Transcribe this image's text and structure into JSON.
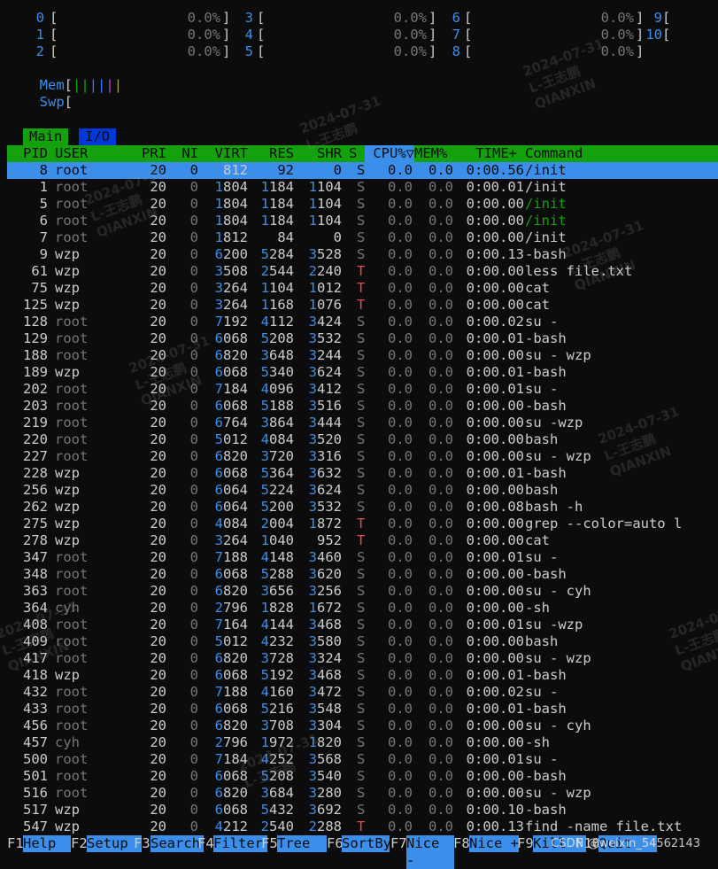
{
  "cpu_meters": [
    {
      "id": "0",
      "pct": "0.0%"
    },
    {
      "id": "1",
      "pct": "0.0%"
    },
    {
      "id": "2",
      "pct": "0.0%"
    },
    {
      "id": "3",
      "pct": "0.0%"
    },
    {
      "id": "4",
      "pct": "0.0%"
    },
    {
      "id": "5",
      "pct": "0.0%"
    },
    {
      "id": "6",
      "pct": "0.0%"
    },
    {
      "id": "7",
      "pct": "0.0%"
    },
    {
      "id": "8",
      "pct": "0.0%"
    },
    {
      "id": "9",
      "pct": ""
    },
    {
      "id": "10",
      "pct": ""
    }
  ],
  "mem": {
    "label": "Mem",
    "bars": "||||||"
  },
  "swp": {
    "label": "Swp"
  },
  "tabs": {
    "main": "Main",
    "io": "I/O"
  },
  "columns": {
    "pid": "PID",
    "user": "USER",
    "pri": "PRI",
    "ni": "NI",
    "virt": "VIRT",
    "res": "RES",
    "shr": "SHR",
    "s": "S",
    "cpu": "CPU%▽",
    "mem": "MEM%",
    "time": "TIME+",
    "command": "Command"
  },
  "processes": [
    {
      "pid": "8",
      "user": "root",
      "pri": "20",
      "ni": "0",
      "virt": "1812",
      "res": "92",
      "shr": "0",
      "s": "S",
      "cpu": "0.0",
      "mem": "0.0",
      "time": "0:00.56",
      "command": "/init",
      "selected": true
    },
    {
      "pid": "1",
      "user": "root",
      "pri": "20",
      "ni": "0",
      "virt": "1804",
      "res": "1184",
      "shr": "1104",
      "s": "S",
      "cpu": "0.0",
      "mem": "0.0",
      "time": "0:00.01",
      "command": "/init"
    },
    {
      "pid": "5",
      "user": "root",
      "pri": "20",
      "ni": "0",
      "virt": "1804",
      "res": "1184",
      "shr": "1104",
      "s": "S",
      "cpu": "0.0",
      "mem": "0.0",
      "time": "0:00.00",
      "command": "/init",
      "thread": true
    },
    {
      "pid": "6",
      "user": "root",
      "pri": "20",
      "ni": "0",
      "virt": "1804",
      "res": "1184",
      "shr": "1104",
      "s": "S",
      "cpu": "0.0",
      "mem": "0.0",
      "time": "0:00.00",
      "command": "/init",
      "thread": true
    },
    {
      "pid": "7",
      "user": "root",
      "pri": "20",
      "ni": "0",
      "virt": "1812",
      "res": "84",
      "shr": "0",
      "s": "S",
      "cpu": "0.0",
      "mem": "0.0",
      "time": "0:00.00",
      "command": "/init"
    },
    {
      "pid": "9",
      "user": "wzp",
      "pri": "20",
      "ni": "0",
      "virt": "6200",
      "res": "5284",
      "shr": "3528",
      "s": "S",
      "cpu": "0.0",
      "mem": "0.0",
      "time": "0:00.13",
      "command": "-bash"
    },
    {
      "pid": "61",
      "user": "wzp",
      "pri": "20",
      "ni": "0",
      "virt": "3508",
      "res": "2544",
      "shr": "2240",
      "s": "T",
      "cpu": "0.0",
      "mem": "0.0",
      "time": "0:00.00",
      "command": "less file.txt"
    },
    {
      "pid": "75",
      "user": "wzp",
      "pri": "20",
      "ni": "0",
      "virt": "3264",
      "res": "1104",
      "shr": "1012",
      "s": "T",
      "cpu": "0.0",
      "mem": "0.0",
      "time": "0:00.00",
      "command": "cat"
    },
    {
      "pid": "125",
      "user": "wzp",
      "pri": "20",
      "ni": "0",
      "virt": "3264",
      "res": "1168",
      "shr": "1076",
      "s": "T",
      "cpu": "0.0",
      "mem": "0.0",
      "time": "0:00.00",
      "command": "cat"
    },
    {
      "pid": "128",
      "user": "root",
      "pri": "20",
      "ni": "0",
      "virt": "7192",
      "res": "4112",
      "shr": "3424",
      "s": "S",
      "cpu": "0.0",
      "mem": "0.0",
      "time": "0:00.02",
      "command": "su -"
    },
    {
      "pid": "129",
      "user": "root",
      "pri": "20",
      "ni": "0",
      "virt": "6068",
      "res": "5208",
      "shr": "3532",
      "s": "S",
      "cpu": "0.0",
      "mem": "0.0",
      "time": "0:00.01",
      "command": "-bash"
    },
    {
      "pid": "188",
      "user": "root",
      "pri": "20",
      "ni": "0",
      "virt": "6820",
      "res": "3648",
      "shr": "3244",
      "s": "S",
      "cpu": "0.0",
      "mem": "0.0",
      "time": "0:00.00",
      "command": "su - wzp"
    },
    {
      "pid": "189",
      "user": "wzp",
      "pri": "20",
      "ni": "0",
      "virt": "6068",
      "res": "5340",
      "shr": "3624",
      "s": "S",
      "cpu": "0.0",
      "mem": "0.0",
      "time": "0:00.01",
      "command": "-bash"
    },
    {
      "pid": "202",
      "user": "root",
      "pri": "20",
      "ni": "0",
      "virt": "7184",
      "res": "4096",
      "shr": "3412",
      "s": "S",
      "cpu": "0.0",
      "mem": "0.0",
      "time": "0:00.01",
      "command": "su -"
    },
    {
      "pid": "203",
      "user": "root",
      "pri": "20",
      "ni": "0",
      "virt": "6068",
      "res": "5188",
      "shr": "3516",
      "s": "S",
      "cpu": "0.0",
      "mem": "0.0",
      "time": "0:00.00",
      "command": "-bash"
    },
    {
      "pid": "219",
      "user": "root",
      "pri": "20",
      "ni": "0",
      "virt": "6764",
      "res": "3864",
      "shr": "3444",
      "s": "S",
      "cpu": "0.0",
      "mem": "0.0",
      "time": "0:00.00",
      "command": "su -wzp"
    },
    {
      "pid": "220",
      "user": "root",
      "pri": "20",
      "ni": "0",
      "virt": "5012",
      "res": "4084",
      "shr": "3520",
      "s": "S",
      "cpu": "0.0",
      "mem": "0.0",
      "time": "0:00.00",
      "command": "bash"
    },
    {
      "pid": "227",
      "user": "root",
      "pri": "20",
      "ni": "0",
      "virt": "6820",
      "res": "3720",
      "shr": "3316",
      "s": "S",
      "cpu": "0.0",
      "mem": "0.0",
      "time": "0:00.00",
      "command": "su - wzp"
    },
    {
      "pid": "228",
      "user": "wzp",
      "pri": "20",
      "ni": "0",
      "virt": "6068",
      "res": "5364",
      "shr": "3632",
      "s": "S",
      "cpu": "0.0",
      "mem": "0.0",
      "time": "0:00.01",
      "command": "-bash"
    },
    {
      "pid": "256",
      "user": "wzp",
      "pri": "20",
      "ni": "0",
      "virt": "6064",
      "res": "5224",
      "shr": "3624",
      "s": "S",
      "cpu": "0.0",
      "mem": "0.0",
      "time": "0:00.00",
      "command": "bash"
    },
    {
      "pid": "262",
      "user": "wzp",
      "pri": "20",
      "ni": "0",
      "virt": "6064",
      "res": "5200",
      "shr": "3532",
      "s": "S",
      "cpu": "0.0",
      "mem": "0.0",
      "time": "0:00.08",
      "command": "bash -h"
    },
    {
      "pid": "275",
      "user": "wzp",
      "pri": "20",
      "ni": "0",
      "virt": "4084",
      "res": "2004",
      "shr": "1872",
      "s": "T",
      "cpu": "0.0",
      "mem": "0.0",
      "time": "0:00.00",
      "command": "grep --color=auto l"
    },
    {
      "pid": "278",
      "user": "wzp",
      "pri": "20",
      "ni": "0",
      "virt": "3264",
      "res": "1040",
      "shr": "952",
      "s": "T",
      "cpu": "0.0",
      "mem": "0.0",
      "time": "0:00.00",
      "command": "cat"
    },
    {
      "pid": "347",
      "user": "root",
      "pri": "20",
      "ni": "0",
      "virt": "7188",
      "res": "4148",
      "shr": "3460",
      "s": "S",
      "cpu": "0.0",
      "mem": "0.0",
      "time": "0:00.01",
      "command": "su -"
    },
    {
      "pid": "348",
      "user": "root",
      "pri": "20",
      "ni": "0",
      "virt": "6068",
      "res": "5288",
      "shr": "3620",
      "s": "S",
      "cpu": "0.0",
      "mem": "0.0",
      "time": "0:00.00",
      "command": "-bash"
    },
    {
      "pid": "363",
      "user": "root",
      "pri": "20",
      "ni": "0",
      "virt": "6820",
      "res": "3656",
      "shr": "3256",
      "s": "S",
      "cpu": "0.0",
      "mem": "0.0",
      "time": "0:00.00",
      "command": "su - cyh"
    },
    {
      "pid": "364",
      "user": "cyh",
      "pri": "20",
      "ni": "0",
      "virt": "2796",
      "res": "1828",
      "shr": "1672",
      "s": "S",
      "cpu": "0.0",
      "mem": "0.0",
      "time": "0:00.00",
      "command": "-sh"
    },
    {
      "pid": "408",
      "user": "root",
      "pri": "20",
      "ni": "0",
      "virt": "7164",
      "res": "4144",
      "shr": "3468",
      "s": "S",
      "cpu": "0.0",
      "mem": "0.0",
      "time": "0:00.01",
      "command": "su -wzp"
    },
    {
      "pid": "409",
      "user": "root",
      "pri": "20",
      "ni": "0",
      "virt": "5012",
      "res": "4232",
      "shr": "3580",
      "s": "S",
      "cpu": "0.0",
      "mem": "0.0",
      "time": "0:00.00",
      "command": "bash"
    },
    {
      "pid": "417",
      "user": "root",
      "pri": "20",
      "ni": "0",
      "virt": "6820",
      "res": "3728",
      "shr": "3324",
      "s": "S",
      "cpu": "0.0",
      "mem": "0.0",
      "time": "0:00.00",
      "command": "su - wzp"
    },
    {
      "pid": "418",
      "user": "wzp",
      "pri": "20",
      "ni": "0",
      "virt": "6068",
      "res": "5192",
      "shr": "3468",
      "s": "S",
      "cpu": "0.0",
      "mem": "0.0",
      "time": "0:00.01",
      "command": "-bash"
    },
    {
      "pid": "432",
      "user": "root",
      "pri": "20",
      "ni": "0",
      "virt": "7188",
      "res": "4160",
      "shr": "3472",
      "s": "S",
      "cpu": "0.0",
      "mem": "0.0",
      "time": "0:00.02",
      "command": "su -"
    },
    {
      "pid": "433",
      "user": "root",
      "pri": "20",
      "ni": "0",
      "virt": "6068",
      "res": "5216",
      "shr": "3548",
      "s": "S",
      "cpu": "0.0",
      "mem": "0.0",
      "time": "0:00.01",
      "command": "-bash"
    },
    {
      "pid": "456",
      "user": "root",
      "pri": "20",
      "ni": "0",
      "virt": "6820",
      "res": "3708",
      "shr": "3304",
      "s": "S",
      "cpu": "0.0",
      "mem": "0.0",
      "time": "0:00.00",
      "command": "su - cyh"
    },
    {
      "pid": "457",
      "user": "cyh",
      "pri": "20",
      "ni": "0",
      "virt": "2796",
      "res": "1972",
      "shr": "1820",
      "s": "S",
      "cpu": "0.0",
      "mem": "0.0",
      "time": "0:00.00",
      "command": "-sh"
    },
    {
      "pid": "500",
      "user": "root",
      "pri": "20",
      "ni": "0",
      "virt": "7184",
      "res": "4252",
      "shr": "3568",
      "s": "S",
      "cpu": "0.0",
      "mem": "0.0",
      "time": "0:00.01",
      "command": "su -"
    },
    {
      "pid": "501",
      "user": "root",
      "pri": "20",
      "ni": "0",
      "virt": "6068",
      "res": "5208",
      "shr": "3540",
      "s": "S",
      "cpu": "0.0",
      "mem": "0.0",
      "time": "0:00.00",
      "command": "-bash"
    },
    {
      "pid": "516",
      "user": "root",
      "pri": "20",
      "ni": "0",
      "virt": "6820",
      "res": "3684",
      "shr": "3280",
      "s": "S",
      "cpu": "0.0",
      "mem": "0.0",
      "time": "0:00.00",
      "command": "su - wzp"
    },
    {
      "pid": "517",
      "user": "wzp",
      "pri": "20",
      "ni": "0",
      "virt": "6068",
      "res": "5432",
      "shr": "3692",
      "s": "S",
      "cpu": "0.0",
      "mem": "0.0",
      "time": "0:00.10",
      "command": "-bash"
    },
    {
      "pid": "547",
      "user": "wzp",
      "pri": "20",
      "ni": "0",
      "virt": "4212",
      "res": "2540",
      "shr": "2288",
      "s": "T",
      "cpu": "0.0",
      "mem": "0.0",
      "time": "0:00.13",
      "command": "find -name file.txt"
    }
  ],
  "footer": [
    {
      "key": "F1",
      "label": "Help"
    },
    {
      "key": "F2",
      "label": "Setup"
    },
    {
      "key": "F3",
      "label": "Search"
    },
    {
      "key": "F4",
      "label": "Filter"
    },
    {
      "key": "F5",
      "label": "Tree"
    },
    {
      "key": "F6",
      "label": "SortBy"
    },
    {
      "key": "F7",
      "label": "Nice -"
    },
    {
      "key": "F8",
      "label": "Nice +"
    },
    {
      "key": "F9",
      "label": "Kill"
    },
    {
      "key": "F10",
      "label": "Quit"
    }
  ],
  "watermark": {
    "date": "2024-07-31",
    "name": "L-王志鹏",
    "org": "QIANXIN"
  },
  "csdn_credit": "CSDN @weixin_54562143",
  "colors": {
    "bg": "#0c0c0c",
    "header_green": "#13a10e",
    "selection_blue": "#3b8eea",
    "stopped_red": "#e74856",
    "user_grey": "#767676"
  }
}
